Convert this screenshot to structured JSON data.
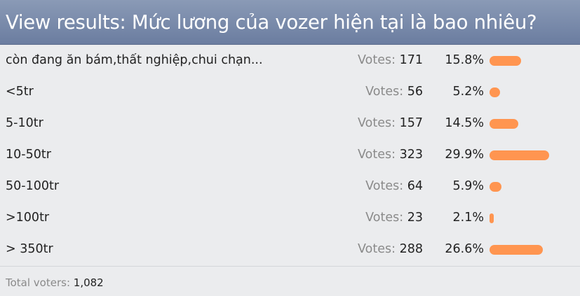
{
  "poll": {
    "header": "View results: Mức lương của vozer hiện tại là bao nhiêu?",
    "votes_label": "Votes:",
    "options": [
      {
        "label": "còn đang ăn bám,thất nghiệp,chui chạn...",
        "votes": "171",
        "percent": "15.8%",
        "share": 0.158
      },
      {
        "label": "<5tr",
        "votes": "56",
        "percent": "5.2%",
        "share": 0.052
      },
      {
        "label": "5-10tr",
        "votes": "157",
        "percent": "14.5%",
        "share": 0.145
      },
      {
        "label": "10-50tr",
        "votes": "323",
        "percent": "29.9%",
        "share": 0.299
      },
      {
        "label": "50-100tr",
        "votes": "64",
        "percent": "5.9%",
        "share": 0.059
      },
      {
        "label": ">100tr",
        "votes": "23",
        "percent": "2.1%",
        "share": 0.021
      },
      {
        "label": "> 350tr",
        "votes": "288",
        "percent": "26.6%",
        "share": 0.266
      }
    ],
    "total_label": "Total voters:",
    "total_voters": "1,082",
    "bar_color": "#ff9550",
    "header_color": "#7586a8"
  }
}
